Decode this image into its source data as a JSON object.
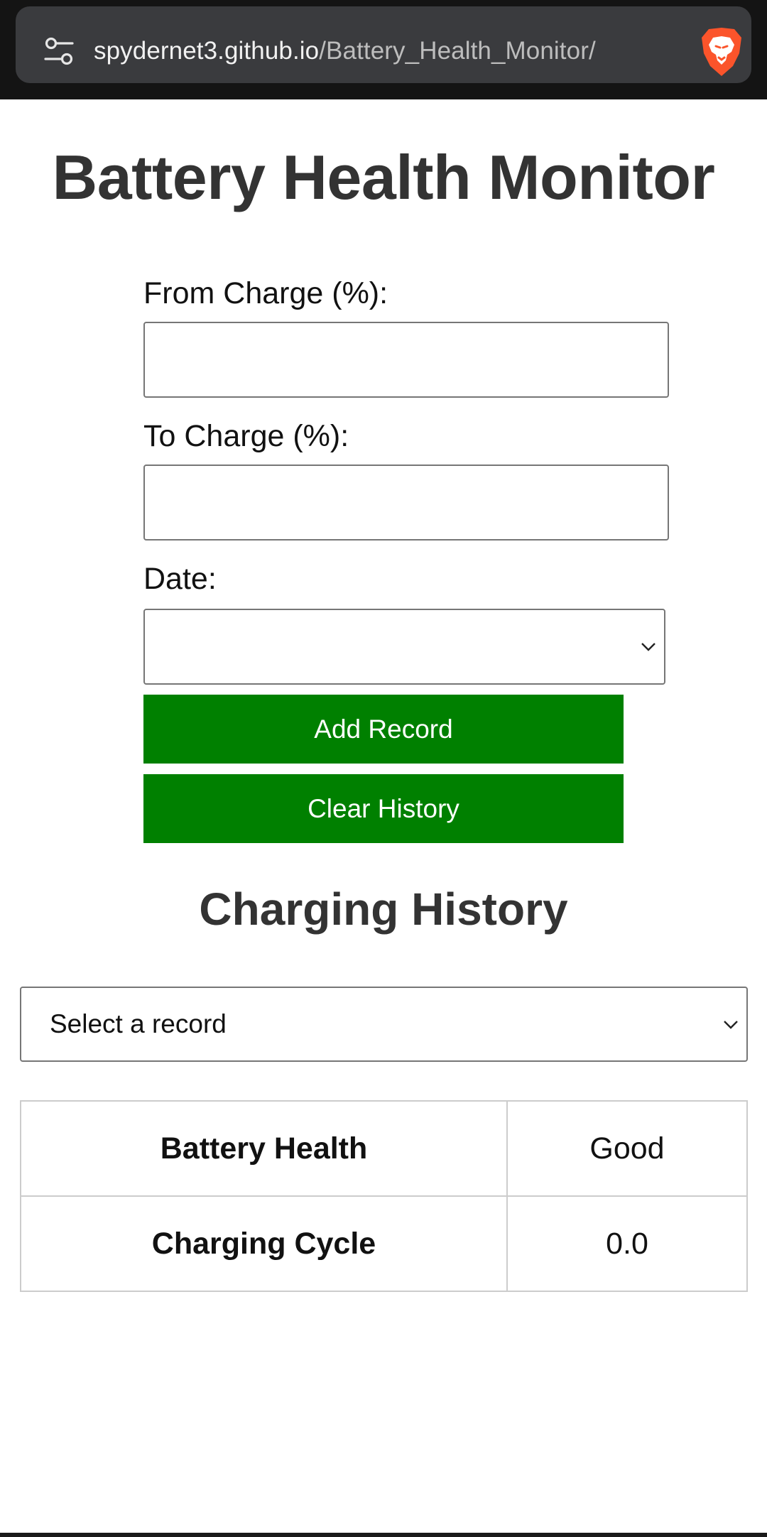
{
  "browser": {
    "url_host": "spydernet3.github.io",
    "url_path": "/Battery_Health_Monitor/",
    "icons": [
      "tune-icon",
      "brave-lion-icon"
    ]
  },
  "page": {
    "title": "Battery Health Monitor",
    "form": {
      "from_label": "From Charge (%):",
      "from_value": "",
      "to_label": "To Charge (%):",
      "to_value": "",
      "date_label": "Date:",
      "date_value": "",
      "add_button": "Add Record",
      "clear_button": "Clear History"
    },
    "history_title": "Charging History",
    "record_select": "Select a record",
    "stats": [
      {
        "label": "Battery Health",
        "value": "Good"
      },
      {
        "label": "Charging Cycle",
        "value": "0.0"
      }
    ]
  },
  "colors": {
    "button_bg": "#008000",
    "heading": "#333333",
    "browser_bar": "#141414",
    "url_pill": "#3a3b3e"
  }
}
